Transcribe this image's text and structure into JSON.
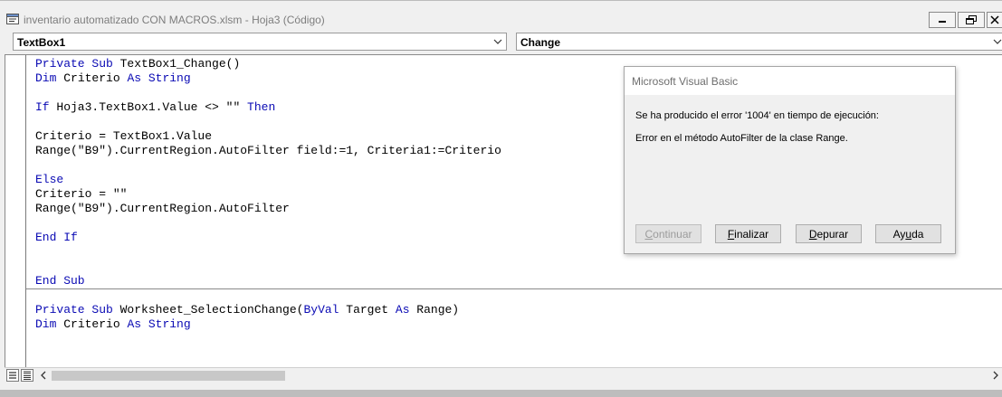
{
  "window": {
    "title": "inventario automatizado CON MACROS.xlsm - Hoja3 (Código)"
  },
  "object_dropdown": {
    "value": "TextBox1"
  },
  "procedure_dropdown": {
    "value": "Change"
  },
  "code": {
    "lines": [
      [
        {
          "t": "Private Sub ",
          "k": true
        },
        {
          "t": "TextBox1_Change()"
        }
      ],
      [
        {
          "t": "Dim ",
          "k": true
        },
        {
          "t": "Criterio "
        },
        {
          "t": "As String",
          "k": true
        }
      ],
      [],
      [
        {
          "t": "If ",
          "k": true
        },
        {
          "t": "Hoja3.TextBox1.Value <> \"\" "
        },
        {
          "t": "Then",
          "k": true
        }
      ],
      [],
      [
        {
          "t": "Criterio = TextBox1.Value"
        }
      ],
      [
        {
          "t": "Range(\"B9\").CurrentRegion.AutoFilter field:=1, Criteria1:=Criterio"
        }
      ],
      [],
      [
        {
          "t": "Else",
          "k": true
        }
      ],
      [
        {
          "t": "Criterio = \"\""
        }
      ],
      [
        {
          "t": "Range(\"B9\").CurrentRegion.AutoFilter"
        }
      ],
      [],
      [
        {
          "t": "End If",
          "k": true
        }
      ],
      [],
      [],
      [
        {
          "t": "End Sub",
          "k": true
        }
      ],
      [],
      [
        {
          "t": "Private Sub ",
          "k": true
        },
        {
          "t": "Worksheet_SelectionChange("
        },
        {
          "t": "ByVal ",
          "k": true
        },
        {
          "t": "Target "
        },
        {
          "t": "As ",
          "k": true
        },
        {
          "t": "Range)"
        }
      ],
      [
        {
          "t": "Dim ",
          "k": true
        },
        {
          "t": "Criterio "
        },
        {
          "t": "As String",
          "k": true
        }
      ]
    ]
  },
  "dialog": {
    "title": "Microsoft Visual Basic",
    "message_line1": "Se ha producido el error '1004' en tiempo de ejecución:",
    "message_line2": "Error en el método AutoFilter de la clase Range.",
    "buttons": {
      "continue": {
        "pre": "",
        "ul": "C",
        "post": "ontinuar"
      },
      "end": {
        "pre": "",
        "ul": "F",
        "post": "inalizar"
      },
      "debug": {
        "pre": "",
        "ul": "D",
        "post": "epurar"
      },
      "help": {
        "pre": "Ay",
        "ul": "u",
        "post": "da"
      }
    }
  },
  "colors": {
    "keyword": "#0a0ab4",
    "code_text": "#000000",
    "title_text": "#7d7d7d"
  },
  "icons": [
    "vba-module-icon",
    "minimize-icon",
    "restore-icon",
    "close-icon",
    "chevron-down-icon",
    "procedure-view-icon",
    "full-module-view-icon",
    "scroll-left-icon",
    "scroll-right-icon"
  ]
}
